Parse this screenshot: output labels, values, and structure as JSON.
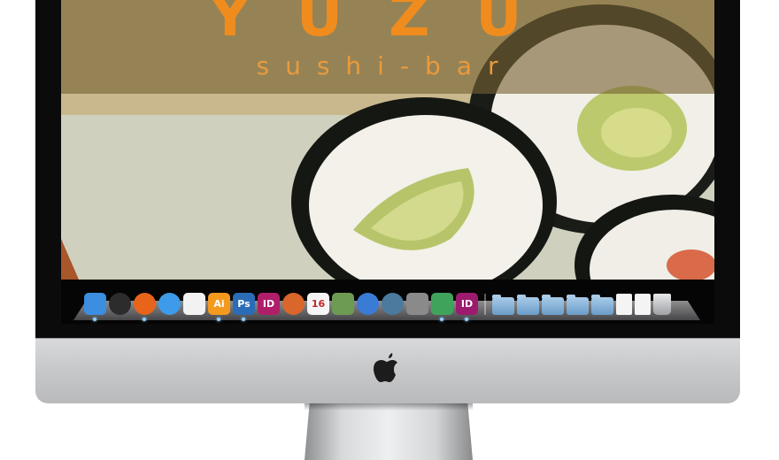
{
  "website": {
    "brand_name": "YUZU",
    "tagline": "sushi-bar"
  },
  "colors": {
    "brand_orange": "#f08c1e",
    "header_overlay": "#786234"
  },
  "dock": {
    "apps": [
      {
        "id": "finder",
        "icon": "finder-icon",
        "label": "",
        "color": "#3b8ee0",
        "running": true
      },
      {
        "id": "dashboard",
        "icon": "dashboard-icon",
        "label": "",
        "color": "#2c2c2c",
        "running": false
      },
      {
        "id": "firefox",
        "icon": "firefox-icon",
        "label": "",
        "color": "#e8641b",
        "running": true
      },
      {
        "id": "safari",
        "icon": "safari-icon",
        "label": "",
        "color": "#3d9be9",
        "running": false
      },
      {
        "id": "acrobat",
        "icon": "acrobat-icon",
        "label": "",
        "color": "#f2f2f2",
        "running": false
      },
      {
        "id": "illustrator",
        "icon": "illustrator-icon",
        "label": "Ai",
        "color": "#f39a1e",
        "running": true
      },
      {
        "id": "photoshop",
        "icon": "photoshop-icon",
        "label": "Ps",
        "color": "#2a6db6",
        "running": true
      },
      {
        "id": "indesign",
        "icon": "indesign-icon",
        "label": "ID",
        "color": "#b01e6a",
        "running": false
      },
      {
        "id": "address-book",
        "icon": "address-book-icon",
        "label": "",
        "color": "#d9662a",
        "running": false
      },
      {
        "id": "ical",
        "icon": "calendar-icon",
        "label": "16",
        "color": "#f5f5f5",
        "running": false
      },
      {
        "id": "iphoto",
        "icon": "iphoto-icon",
        "label": "",
        "color": "#6e9b54",
        "running": false
      },
      {
        "id": "itunes",
        "icon": "itunes-icon",
        "label": "",
        "color": "#3a7bd5",
        "running": false
      },
      {
        "id": "time-machine",
        "icon": "time-machine-icon",
        "label": "",
        "color": "#4b7a9e",
        "running": false
      },
      {
        "id": "system-preferences",
        "icon": "system-preferences-icon",
        "label": "",
        "color": "#8a8a8a",
        "running": false
      },
      {
        "id": "preview",
        "icon": "preview-icon",
        "label": "",
        "color": "#3fa35b",
        "running": true
      },
      {
        "id": "indesign-cs",
        "icon": "indesign-icon",
        "label": "ID",
        "color": "#9c1b6e",
        "running": true
      }
    ],
    "stacks": [
      {
        "id": "folder-1",
        "icon": "folder-icon"
      },
      {
        "id": "pdf-folder",
        "icon": "pdf-folder-icon"
      },
      {
        "id": "folder-2",
        "icon": "folder-icon"
      },
      {
        "id": "applications-folder",
        "icon": "applications-folder-icon"
      },
      {
        "id": "documents-folder",
        "icon": "documents-folder-icon"
      },
      {
        "id": "document",
        "icon": "document-icon"
      },
      {
        "id": "mail-stack",
        "icon": "mail-icon"
      },
      {
        "id": "trash",
        "icon": "trash-icon"
      }
    ]
  }
}
